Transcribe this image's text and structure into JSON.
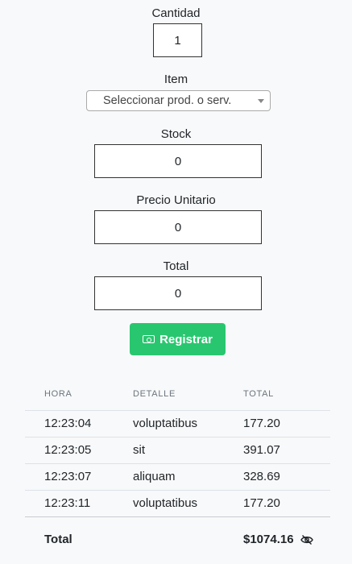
{
  "form": {
    "cantidad_label": "Cantidad",
    "cantidad_value": "1",
    "item_label": "Item",
    "item_placeholder": "Seleccionar prod. o serv.",
    "stock_label": "Stock",
    "stock_value": "0",
    "precio_label": "Precio Unitario",
    "precio_value": "0",
    "total_label": "Total",
    "total_value": "0",
    "register_button": "Registrar"
  },
  "table": {
    "headers": [
      "HORA",
      "DETALLE",
      "TOTAL"
    ],
    "rows": [
      {
        "hora": "12:23:04",
        "detalle": "voluptatibus",
        "total": "177.20"
      },
      {
        "hora": "12:23:05",
        "detalle": "sit",
        "total": "391.07"
      },
      {
        "hora": "12:23:07",
        "detalle": "aliquam",
        "total": "328.69"
      },
      {
        "hora": "12:23:11",
        "detalle": "voluptatibus",
        "total": "177.20"
      }
    ],
    "footer_label": "Total",
    "footer_value": "$1074.16"
  },
  "colors": {
    "button": "#28c76f",
    "background": "#f8f9fa"
  },
  "icons": {
    "button_icon": "money-bill-icon",
    "total_icon": "eye-slash-icon"
  }
}
